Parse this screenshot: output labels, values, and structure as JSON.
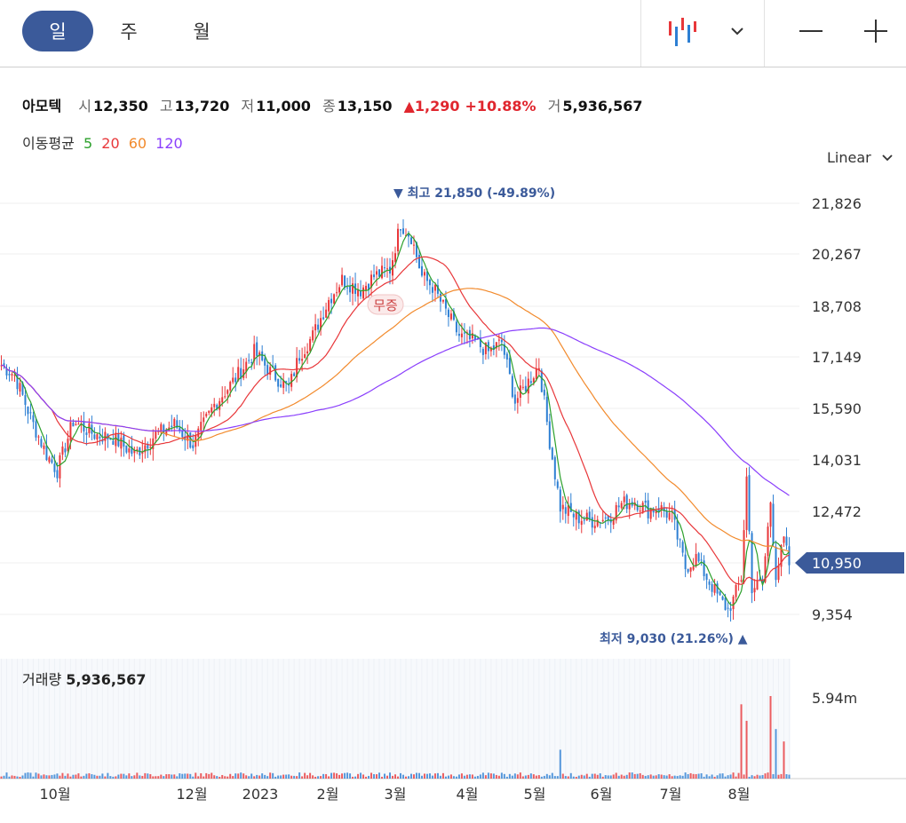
{
  "toolbar": {
    "periods": [
      "일",
      "주",
      "월"
    ],
    "active_period": "일",
    "chart_type_icon": "candlestick-icon",
    "dropdown_icon": "chevron-down-icon",
    "zoom_out_icon": "minus-icon",
    "zoom_in_icon": "plus-icon"
  },
  "quote": {
    "name": "아모텍",
    "open_label": "시",
    "open": "12,350",
    "high_label": "고",
    "high": "13,720",
    "low_label": "저",
    "low": "11,000",
    "close_label": "종",
    "close": "13,150",
    "change": "1,290",
    "change_pct": "+10.88%",
    "volume_label": "거",
    "volume": "5,936,567"
  },
  "ma_legend": {
    "label": "이동평균",
    "items": [
      {
        "period": "5",
        "color": "#2ca02c"
      },
      {
        "period": "20",
        "color": "#e8373a"
      },
      {
        "period": "60",
        "color": "#f28a2c"
      },
      {
        "period": "120",
        "color": "#8a3ffc"
      }
    ]
  },
  "scale": {
    "label": "Linear"
  },
  "volume_panel": {
    "label": "거래량",
    "value": "5,936,567",
    "axis_label": "5.94m"
  },
  "chart_data": {
    "type": "candlestick",
    "y_ticks": [
      "21,826",
      "20,267",
      "18,708",
      "17,149",
      "15,590",
      "14,031",
      "12,472",
      "10,950",
      "9,354"
    ],
    "ylim": [
      9000,
      22400
    ],
    "x_ticks": [
      "10월",
      "12월",
      "2023",
      "2월",
      "3월",
      "4월",
      "5월",
      "6월",
      "7월",
      "8월"
    ],
    "current_price": "10,950",
    "high_marker": {
      "label": "최고",
      "value": "21,850",
      "pct": "(-49.89%)"
    },
    "low_marker": {
      "label": "최저",
      "value": "9,030",
      "pct": "(21.26%)"
    },
    "event_marker": "무증",
    "colors": {
      "up": "#e8373a",
      "down": "#2d7fd3",
      "accent": "#3b5a9a"
    },
    "close_anchors": [
      [
        0,
        16900
      ],
      [
        5,
        16600
      ],
      [
        12,
        15100
      ],
      [
        17,
        14200
      ],
      [
        21,
        13700
      ],
      [
        27,
        15200
      ],
      [
        35,
        14800
      ],
      [
        42,
        14700
      ],
      [
        50,
        14200
      ],
      [
        58,
        14800
      ],
      [
        65,
        15100
      ],
      [
        72,
        14500
      ],
      [
        80,
        15700
      ],
      [
        88,
        16500
      ],
      [
        95,
        17300
      ],
      [
        101,
        16700
      ],
      [
        108,
        16200
      ],
      [
        112,
        17200
      ],
      [
        117,
        17800
      ],
      [
        123,
        18900
      ],
      [
        128,
        19500
      ],
      [
        135,
        19200
      ],
      [
        140,
        19600
      ],
      [
        146,
        19800
      ],
      [
        150,
        21200
      ],
      [
        154,
        20800
      ],
      [
        158,
        19600
      ],
      [
        162,
        19300
      ],
      [
        168,
        18400
      ],
      [
        172,
        17800
      ],
      [
        178,
        17600
      ],
      [
        183,
        17300
      ],
      [
        188,
        17600
      ],
      [
        193,
        15800
      ],
      [
        198,
        16400
      ],
      [
        202,
        16900
      ],
      [
        206,
        14600
      ],
      [
        210,
        12600
      ],
      [
        216,
        12300
      ],
      [
        222,
        12200
      ],
      [
        228,
        12300
      ],
      [
        233,
        12700
      ],
      [
        238,
        12800
      ],
      [
        243,
        12500
      ],
      [
        247,
        12600
      ],
      [
        252,
        12300
      ],
      [
        257,
        10800
      ],
      [
        261,
        11100
      ],
      [
        265,
        10500
      ],
      [
        270,
        9800
      ],
      [
        273,
        9500
      ],
      [
        275,
        9800
      ],
      [
        278,
        10500
      ],
      [
        280,
        13500
      ],
      [
        282,
        10200
      ],
      [
        286,
        10300
      ],
      [
        289,
        12800
      ],
      [
        291,
        10600
      ],
      [
        294,
        11600
      ],
      [
        296,
        10900
      ]
    ],
    "volume_spikes": [
      [
        210,
        0.35
      ],
      [
        278,
        0.9
      ],
      [
        280,
        0.7
      ],
      [
        289,
        1.0
      ],
      [
        291,
        0.6
      ],
      [
        294,
        0.45
      ]
    ]
  }
}
